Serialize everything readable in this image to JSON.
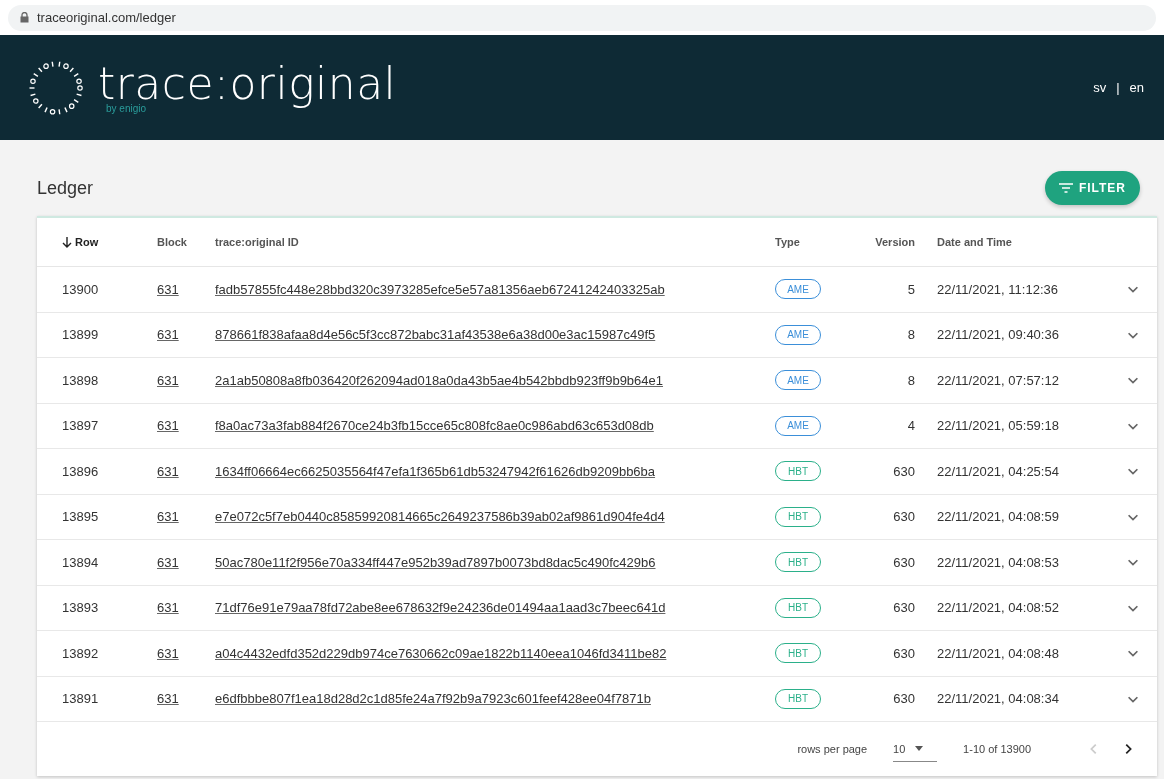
{
  "browser": {
    "url": "traceoriginal.com/ledger"
  },
  "header": {
    "brand": "trace:original",
    "byline": "by enigio",
    "languages": [
      {
        "label": "sv",
        "selected": false
      },
      {
        "label": "en",
        "selected": false
      }
    ],
    "separator": "|"
  },
  "page": {
    "title": "Ledger",
    "filter_button": "FILTER"
  },
  "table": {
    "columns": [
      {
        "label": "Row",
        "sorted": true
      },
      {
        "label": "Block",
        "sorted": false
      },
      {
        "label": "trace:original ID",
        "sorted": false
      },
      {
        "label": "Type",
        "sorted": false
      },
      {
        "label": "Version",
        "sorted": false
      },
      {
        "label": "Date and Time",
        "sorted": false
      }
    ],
    "rows": [
      {
        "row": "13900",
        "block": "631",
        "id": "fadb57855fc448e28bbd320c3973285efce5e57a81356aeb67241242403325ab",
        "type": "AME",
        "color": "#3b8fd9",
        "version": "5",
        "datetime": "22/11/2021, 11:12:36",
        "expanded": false
      },
      {
        "row": "13899",
        "block": "631",
        "id": "878661f838afaa8d4e56c5f3cc872babc31af43538e6a38d00e3ac15987c49f5",
        "type": "AME",
        "color": "#3b8fd9",
        "version": "8",
        "datetime": "22/11/2021, 09:40:36",
        "expanded": false
      },
      {
        "row": "13898",
        "block": "631",
        "id": "2a1ab50808a8fb036420f262094ad018a0da43b5ae4b542bbdb923ff9b9b64e1",
        "type": "AME",
        "color": "#3b8fd9",
        "version": "8",
        "datetime": "22/11/2021, 07:57:12",
        "expanded": false
      },
      {
        "row": "13897",
        "block": "631",
        "id": "f8a0ac73a3fab884f2670ce24b3fb15cce65c808fc8ae0c986abd63c653d08db",
        "type": "AME",
        "color": "#3b8fd9",
        "version": "4",
        "datetime": "22/11/2021, 05:59:18",
        "expanded": false
      },
      {
        "row": "13896",
        "block": "631",
        "id": "1634ff06664ec6625035564f47efa1f365b61db53247942f61626db9209bb6ba",
        "type": "HBT",
        "color": "#2bb08a",
        "version": "630",
        "datetime": "22/11/2021, 04:25:54",
        "expanded": false
      },
      {
        "row": "13895",
        "block": "631",
        "id": "e7e072c5f7eb0440c85859920814665c2649237586b39ab02af9861d904fe4d4",
        "type": "HBT",
        "color": "#2bb08a",
        "version": "630",
        "datetime": "22/11/2021, 04:08:59",
        "expanded": false
      },
      {
        "row": "13894",
        "block": "631",
        "id": "50ac780e11f2f956e70a334ff447e952b39ad7897b0073bd8dac5c490fc429b6",
        "type": "HBT",
        "color": "#2bb08a",
        "version": "630",
        "datetime": "22/11/2021, 04:08:53",
        "expanded": false
      },
      {
        "row": "13893",
        "block": "631",
        "id": "71df76e91e79aa78fd72abe8ee678632f9e24236de01494aa1aad3c7beec641d",
        "type": "HBT",
        "color": "#2bb08a",
        "version": "630",
        "datetime": "22/11/2021, 04:08:52",
        "expanded": false
      },
      {
        "row": "13892",
        "block": "631",
        "id": "a04c4432edfd352d229db974ce7630662c09ae1822b1140eea1046fd3411be82",
        "type": "HBT",
        "color": "#2bb08a",
        "version": "630",
        "datetime": "22/11/2021, 04:08:48",
        "expanded": false
      },
      {
        "row": "13891",
        "block": "631",
        "id": "e6dfbbbe807f1ea18d28d2c1d85fe24a7f92b9a7923c601feef428ee04f7871b",
        "type": "HBT",
        "color": "#2bb08a",
        "version": "630",
        "datetime": "22/11/2021, 04:08:34",
        "expanded": false
      }
    ]
  },
  "pagination": {
    "rows_per_page_label": "rows per page",
    "rows_per_page": "10",
    "range": "1-10 of 13900",
    "previous_disabled": true,
    "next_disabled": false
  }
}
